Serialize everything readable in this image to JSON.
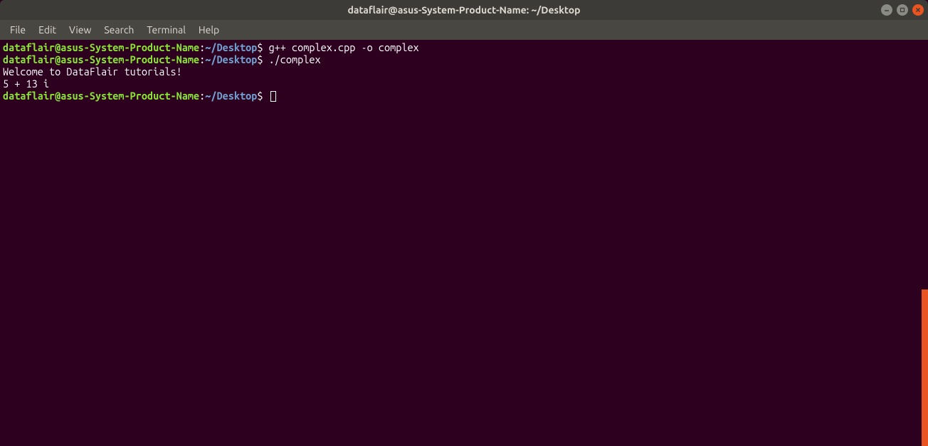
{
  "window": {
    "title": "dataflair@asus-System-Product-Name: ~/Desktop"
  },
  "menu": {
    "file": "File",
    "edit": "Edit",
    "view": "View",
    "search": "Search",
    "terminal": "Terminal",
    "help": "Help"
  },
  "prompt": {
    "user_host": "dataflair@asus-System-Product-Name",
    "colon": ":",
    "tilde": "~",
    "path": "/Desktop",
    "dollar": "$ "
  },
  "lines": {
    "cmd1": "g++ complex.cpp -o complex",
    "cmd2": "./complex",
    "out1": "Welcome to DataFlair tutorials!",
    "blank": "",
    "out2": "5 + 13 i"
  }
}
